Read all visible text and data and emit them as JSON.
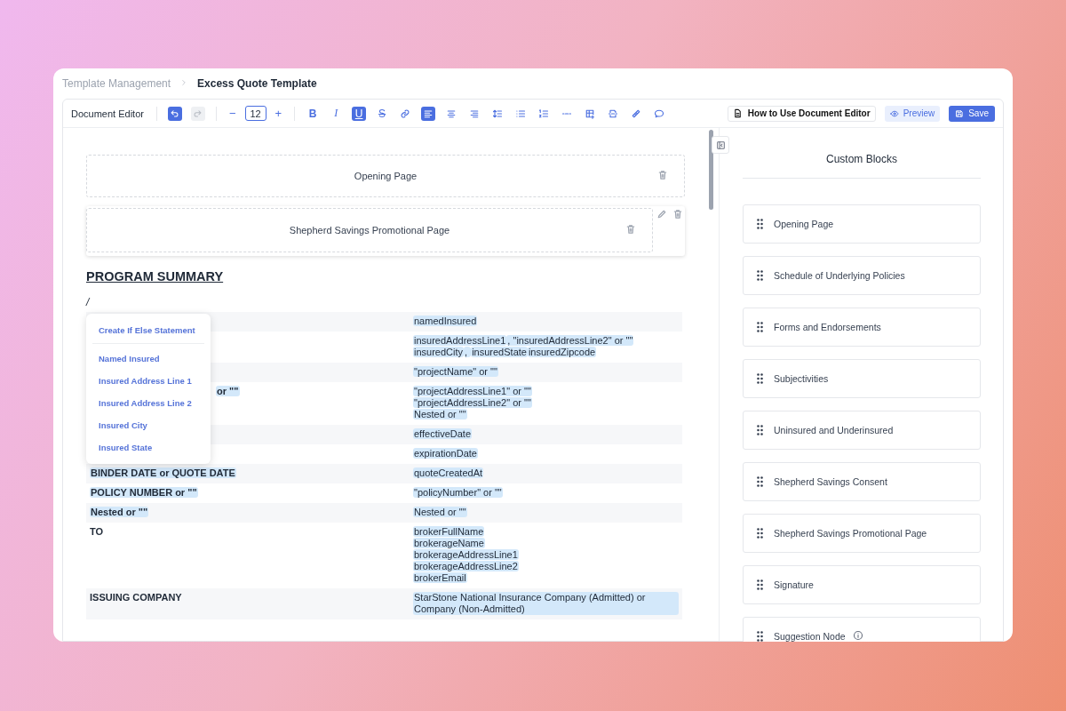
{
  "breadcrumb": [
    {
      "label": "Template Management",
      "current": false
    },
    {
      "label": "Excess Quote Template",
      "current": true
    }
  ],
  "toolbar": {
    "title": "Document Editor",
    "font_size": "12",
    "history": [
      {
        "kind": "undo",
        "enabled": true
      },
      {
        "kind": "redo",
        "enabled": false
      }
    ],
    "size_steps": [
      "−",
      "+"
    ],
    "format": [
      {
        "kind": "bold",
        "glyph": "B",
        "active": false
      },
      {
        "kind": "italic",
        "glyph": "I",
        "active": false
      },
      {
        "kind": "underline",
        "glyph": "U",
        "active": true
      },
      {
        "kind": "strike",
        "glyph": "S",
        "active": false
      },
      {
        "kind": "link",
        "active": false
      },
      {
        "kind": "align-left",
        "active": true
      },
      {
        "kind": "align-center",
        "active": false
      },
      {
        "kind": "align-right",
        "active": false
      },
      {
        "kind": "line-height",
        "active": false
      },
      {
        "kind": "bullets",
        "active": false
      },
      {
        "kind": "numbers",
        "active": false
      },
      {
        "kind": "rule",
        "active": false
      },
      {
        "kind": "table",
        "active": false
      },
      {
        "kind": "page-break",
        "active": false
      },
      {
        "kind": "ruler",
        "active": false
      },
      {
        "kind": "comment",
        "active": false
      }
    ],
    "help": "How to Use Document Editor",
    "preview": "Preview",
    "save": "Save"
  },
  "document": {
    "blocks": [
      {
        "title": "Opening Page",
        "selected": false
      },
      {
        "title": "Shepherd Savings Promotional Page",
        "selected": true
      }
    ],
    "heading": "PROGRAM SUMMARY",
    "cursor_text": "/",
    "rows": [
      {
        "values": [
          [
            "namedInsured"
          ]
        ]
      },
      {
        "values": [
          [
            "insuredAddressLine1",
            ", \"insuredAddressLine2\" or \"\""
          ],
          [
            "insuredCity",
            ", ",
            "insuredState",
            "insuredZipcode"
          ]
        ]
      },
      {
        "values": [
          [
            "\"projectName\" or \"\""
          ]
        ]
      },
      {
        "label": "or \"\"",
        "label_highlighted": true,
        "label_covered": true,
        "values": [
          [
            "\"projectAddressLine1\" or \"\""
          ],
          [
            "\"projectAddressLine2\" or \"\""
          ],
          [
            "Nested or \"\""
          ]
        ]
      },
      {
        "values": [
          [
            "effectiveDate"
          ]
        ]
      },
      {
        "values": [
          [
            "expirationDate"
          ]
        ]
      },
      {
        "label": "BINDER DATE or QUOTE DATE",
        "label_highlighted": true,
        "values": [
          [
            "quoteCreatedAt"
          ]
        ]
      },
      {
        "label": "POLICY NUMBER or \"\"",
        "label_highlighted": true,
        "values": [
          [
            "\"policyNumber\" or \"\""
          ]
        ]
      },
      {
        "label": "Nested or \"\"",
        "label_highlighted": true,
        "values": [
          [
            "Nested or \"\""
          ]
        ]
      },
      {
        "label": "TO",
        "label_highlighted": false,
        "values": [
          [
            "brokerFullName"
          ],
          [
            "brokerageName"
          ],
          [
            "brokerageAddressLine1"
          ],
          [
            "brokerageAddressLine2"
          ],
          [
            "brokerEmail"
          ]
        ]
      },
      {
        "label": "ISSUING COMPANY",
        "label_highlighted": false,
        "values": [
          [
            "StarStone National Insurance Company (Admitted) or Company (Non-Admitted)"
          ]
        ]
      }
    ],
    "menu": {
      "action": "Create If Else Statement",
      "items": [
        "Named Insured",
        "Insured Address Line 1",
        "Insured Address Line 2",
        "Insured City",
        "Insured State"
      ]
    }
  },
  "panel": {
    "title": "Custom Blocks",
    "items": [
      {
        "label": "Opening Page",
        "info": false
      },
      {
        "label": "Schedule of Underlying Policies",
        "info": false
      },
      {
        "label": "Forms and Endorsements",
        "info": false
      },
      {
        "label": "Subjectivities",
        "info": false
      },
      {
        "label": "Uninsured and Underinsured",
        "info": false
      },
      {
        "label": "Shepherd Savings Consent",
        "info": false
      },
      {
        "label": "Shepherd Savings Promotional Page",
        "info": false
      },
      {
        "label": "Signature",
        "info": false
      },
      {
        "label": "Suggestion Node",
        "info": true
      }
    ]
  }
}
